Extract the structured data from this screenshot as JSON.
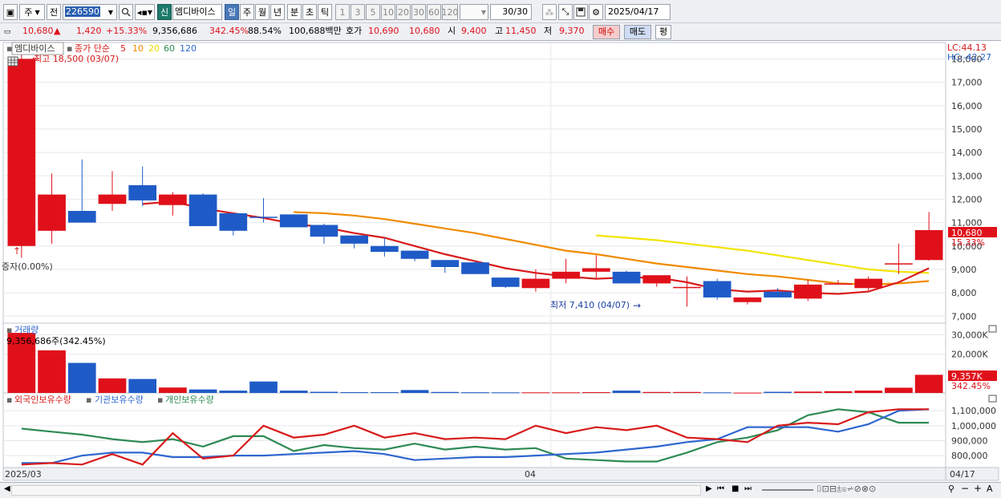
{
  "toolbar": {
    "period": "주",
    "prev": "전",
    "code": "226590",
    "new_badge": "신",
    "stock_name": "엠디바이스",
    "periods": [
      "일",
      "주",
      "월",
      "년",
      "분",
      "초",
      "틱"
    ],
    "numbers": [
      "1",
      "3",
      "5",
      "10",
      "20",
      "30",
      "60",
      "120"
    ],
    "page": "30/30",
    "date": "2025/04/17"
  },
  "quote": {
    "price": "10,680",
    "change": "1,420",
    "change_pct": "+15.33%",
    "volume": "9,356,686",
    "vol_ratio": "342.45%",
    "ratio2": "88.54%",
    "amount": "100,688백만",
    "hoga_label": "호가",
    "hoga_ask": "10,690",
    "hoga_bid": "10,680",
    "open_label": "시",
    "open": "9,400",
    "high_label": "고",
    "high": "11,450",
    "low_label": "저",
    "low": "9,370",
    "buy": "매수",
    "sell": "매도",
    "eval": "평"
  },
  "legend": {
    "name": "엠디바이스",
    "ma_label": "종가 단순",
    "ma_periods": [
      "5",
      "10",
      "20",
      "60",
      "120"
    ],
    "high_note": "최고 18,500 (03/07)",
    "low_note": "최저 7,410 (04/07)",
    "event_note": "증자(0.00%)",
    "lc": "LC:44.13",
    "hc": "HC:-42.27",
    "last_price": "10,680",
    "last_pct": "15.33%"
  },
  "volume_panel": {
    "title": "거래량",
    "note": "9,356,686주(342.45%)",
    "last": "9,357K",
    "last_pct": "342.45%"
  },
  "holdings_panel": {
    "foreign": "외국인보유수량",
    "institution": "기관보유수량",
    "individual": "개인보유수량"
  },
  "x_axis": {
    "start": "2025/03",
    "mid": "04",
    "end": "04/17"
  },
  "colors": {
    "up": "#e0101a",
    "down": "#1f5bc7",
    "ma5": "#d81b1b",
    "ma10": "#f08a00",
    "ma20": "#f2e400",
    "foreign": "#d81b1b",
    "institution": "#2f66d0",
    "individual": "#2e8a55"
  },
  "chart_data": {
    "type": "candlestick",
    "dates": [
      "03/06",
      "03/07",
      "03/10",
      "03/11",
      "03/12",
      "03/13",
      "03/14",
      "03/17",
      "03/18",
      "03/19",
      "03/20",
      "03/21",
      "03/24",
      "03/25",
      "03/26",
      "03/27",
      "03/28",
      "03/31",
      "04/01",
      "04/02",
      "04/03",
      "04/04",
      "04/07",
      "04/08",
      "04/09",
      "04/10",
      "04/11",
      "04/14",
      "04/15",
      "04/16",
      "04/17"
    ],
    "open": [
      10000,
      10650,
      11500,
      11800,
      12600,
      11750,
      12200,
      11400,
      11250,
      11350,
      10900,
      10450,
      10000,
      9800,
      9400,
      9300,
      8650,
      8200,
      8600,
      8900,
      8900,
      8400,
      8250,
      8500,
      7600,
      8050,
      7750,
      8400,
      8200,
      9260,
      9400
    ],
    "high": [
      18500,
      13100,
      13700,
      13200,
      13400,
      12300,
      12250,
      11400,
      12050,
      11350,
      10950,
      10450,
      10350,
      9800,
      9400,
      9350,
      8650,
      9000,
      9450,
      9600,
      8950,
      8750,
      8700,
      8600,
      7800,
      8200,
      8550,
      8550,
      8700,
      10100,
      11450
    ],
    "low": [
      9500,
      10100,
      11300,
      11500,
      11700,
      11300,
      10900,
      10450,
      11000,
      10800,
      10100,
      9900,
      9550,
      9350,
      8850,
      8850,
      8200,
      8050,
      8400,
      8600,
      8400,
      8250,
      7410,
      7700,
      7500,
      7850,
      7650,
      8350,
      8100,
      8800,
      9370
    ],
    "close": [
      18000,
      12200,
      11000,
      12200,
      11950,
      12200,
      10850,
      10650,
      11200,
      10800,
      10400,
      10100,
      9750,
      9450,
      9100,
      8800,
      8250,
      8600,
      8900,
      9050,
      8400,
      8750,
      8250,
      7800,
      7800,
      7800,
      8350,
      8400,
      8600,
      9260,
      10680
    ],
    "ma5_from": 4,
    "ma5": [
      null,
      null,
      null,
      null,
      11800,
      11900,
      11600,
      11400,
      11200,
      10950,
      10800,
      10550,
      10350,
      10000,
      9650,
      9350,
      9050,
      8850,
      8700,
      8600,
      8650,
      8650,
      8450,
      8150,
      8050,
      8100,
      8000,
      7950,
      8050,
      8450,
      9050
    ],
    "ma10": [
      null,
      null,
      null,
      null,
      null,
      null,
      null,
      null,
      null,
      11450,
      11400,
      11300,
      11150,
      10950,
      10750,
      10550,
      10300,
      10050,
      9800,
      9650,
      9450,
      9250,
      9100,
      8950,
      8800,
      8700,
      8550,
      8400,
      8350,
      8400,
      8500
    ],
    "ma20": [
      null,
      null,
      null,
      null,
      null,
      null,
      null,
      null,
      null,
      null,
      null,
      null,
      null,
      null,
      null,
      null,
      null,
      null,
      null,
      10450,
      10350,
      10250,
      10100,
      9950,
      9800,
      9600,
      9400,
      9200,
      9000,
      8900,
      8850
    ],
    "ylim": [
      6700,
      18700
    ],
    "y_ticks": [
      "7,000",
      "8,000",
      "9,000",
      "10,000",
      "11,000",
      "12,000",
      "13,000",
      "14,000",
      "15,000",
      "16,000",
      "17,000",
      "18,000"
    ],
    "volume": [
      31000,
      22000,
      15500,
      7500,
      7200,
      2800,
      1800,
      1200,
      5900,
      1200,
      600,
      400,
      400,
      1500,
      500,
      350,
      300,
      300,
      300,
      400,
      1200,
      500,
      500,
      300,
      150,
      600,
      700,
      900,
      1200,
      2700,
      9357
    ],
    "volume_ylim": [
      0,
      36000
    ],
    "volume_ticks": [
      "20,000K",
      "30,000K"
    ],
    "foreign_hold": [
      740000,
      750000,
      740000,
      810000,
      740000,
      950000,
      780000,
      800000,
      1000000,
      920000,
      940000,
      1000000,
      920000,
      950000,
      910000,
      920000,
      910000,
      1000000,
      950000,
      990000,
      970000,
      1000000,
      920000,
      910000,
      890000,
      1000000,
      1020000,
      1010000,
      1090000,
      1110000,
      1110000
    ],
    "institution_hold": [
      750000,
      750000,
      800000,
      820000,
      820000,
      790000,
      790000,
      800000,
      800000,
      810000,
      820000,
      830000,
      810000,
      770000,
      780000,
      790000,
      790000,
      800000,
      810000,
      820000,
      840000,
      860000,
      890000,
      910000,
      990000,
      990000,
      990000,
      960000,
      1010000,
      1100000,
      1110000
    ],
    "individual_hold": [
      980000,
      960000,
      940000,
      910000,
      890000,
      910000,
      860000,
      930000,
      930000,
      830000,
      870000,
      850000,
      840000,
      880000,
      840000,
      860000,
      840000,
      850000,
      780000,
      770000,
      760000,
      760000,
      820000,
      890000,
      920000,
      970000,
      1070000,
      1110000,
      1090000,
      1020000,
      1020000
    ],
    "hold_ylim": [
      720000,
      1160000
    ],
    "hold_ticks": [
      "800,000",
      "900,000",
      "1,000,000",
      "1,100,000"
    ]
  }
}
